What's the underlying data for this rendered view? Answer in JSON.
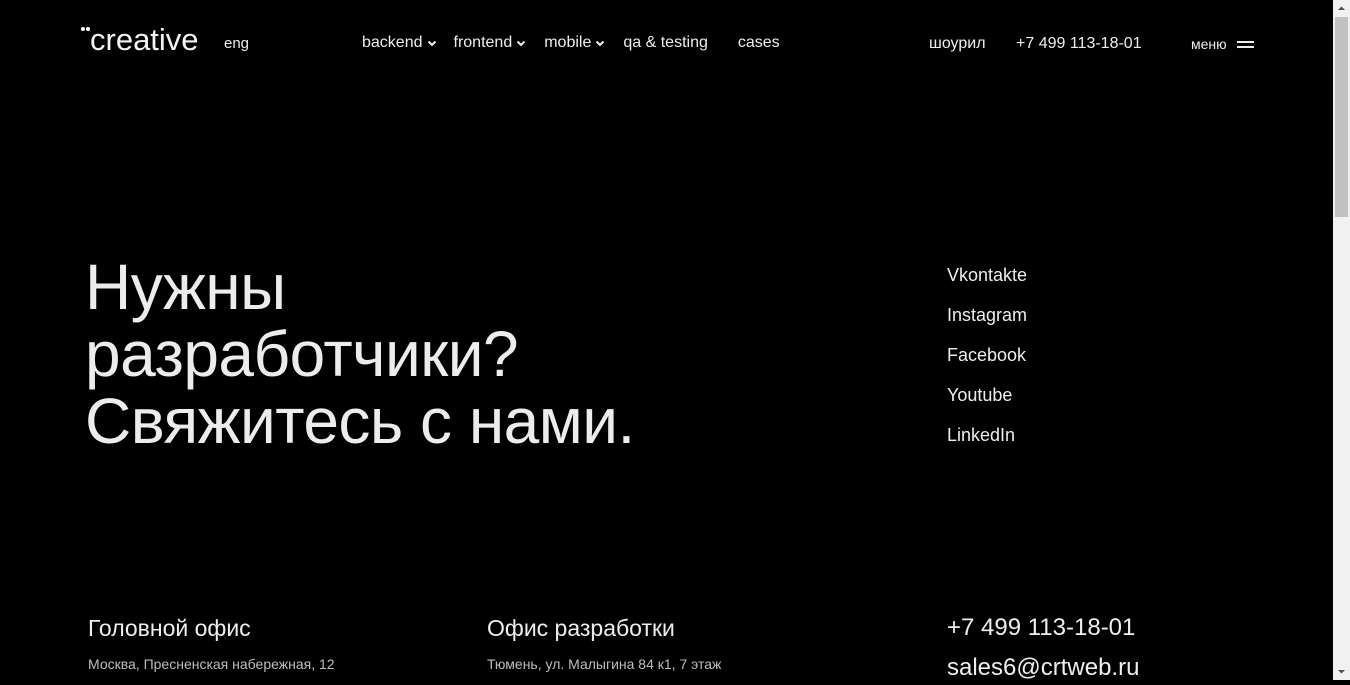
{
  "header": {
    "logo": "creative",
    "lang": "eng",
    "nav": [
      {
        "label": "backend",
        "dropdown": true
      },
      {
        "label": "frontend",
        "dropdown": true
      },
      {
        "label": "mobile",
        "dropdown": true
      },
      {
        "label": "qa & testing",
        "dropdown": false
      },
      {
        "label": "cases",
        "dropdown": false
      }
    ],
    "showreel": "шоурил",
    "phone": "+7 499 113-18-01",
    "menu": "меню"
  },
  "hero": {
    "line1": "Нужны",
    "line2": "разработчики?",
    "line3": "Свяжитесь с нами."
  },
  "socials": [
    "Vkontakte",
    "Instagram",
    "Facebook",
    "Youtube",
    "LinkedIn"
  ],
  "offices": {
    "head": {
      "title": "Головной офис",
      "address": "Москва, Пресненская набережная, 12"
    },
    "dev": {
      "title": "Офис разработки",
      "address": "Тюмень, ул. Малыгина 84 к1, 7 этаж"
    }
  },
  "contacts": {
    "phone": "+7 499 113-18-01",
    "email": "sales6@crtweb.ru"
  },
  "colors": {
    "background": "#000000",
    "text": "#eeeeee",
    "muted": "#bdbdbd"
  }
}
